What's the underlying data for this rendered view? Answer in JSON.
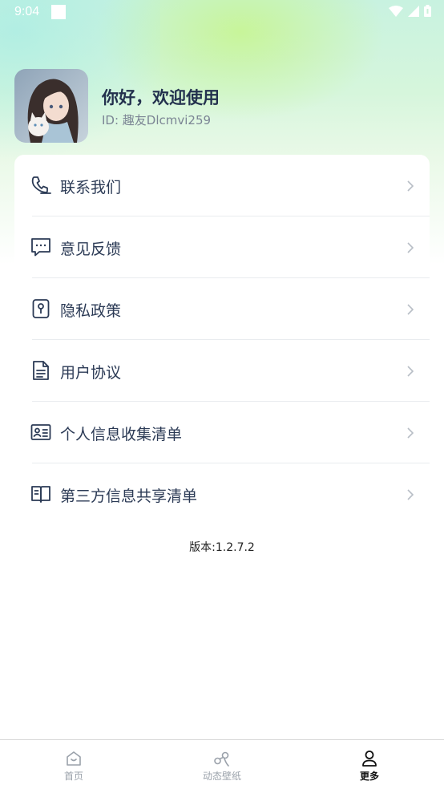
{
  "status_bar": {
    "time": "9:04"
  },
  "profile": {
    "greeting": "你好，欢迎使用",
    "user_id": "ID: 趣友Dlcmvi259"
  },
  "menu": {
    "items": [
      {
        "label": "联系我们",
        "icon": "phone-icon"
      },
      {
        "label": "意见反馈",
        "icon": "chat-bubble-icon"
      },
      {
        "label": "隐私政策",
        "icon": "keyhole-icon"
      },
      {
        "label": "用户协议",
        "icon": "document-icon"
      },
      {
        "label": "个人信息收集清单",
        "icon": "id-card-icon"
      },
      {
        "label": "第三方信息共享清单",
        "icon": "open-book-icon"
      }
    ]
  },
  "version": "版本:1.2.7.2",
  "bottom_nav": {
    "items": [
      {
        "label": "首页",
        "icon": "home-icon",
        "active": false
      },
      {
        "label": "动态壁纸",
        "icon": "wallpaper-icon",
        "active": false
      },
      {
        "label": "更多",
        "icon": "user-icon",
        "active": true
      }
    ]
  },
  "colors": {
    "accent_text": "#23314e",
    "divider": "#e9ecef",
    "inactive_nav": "#9aa1aa"
  }
}
